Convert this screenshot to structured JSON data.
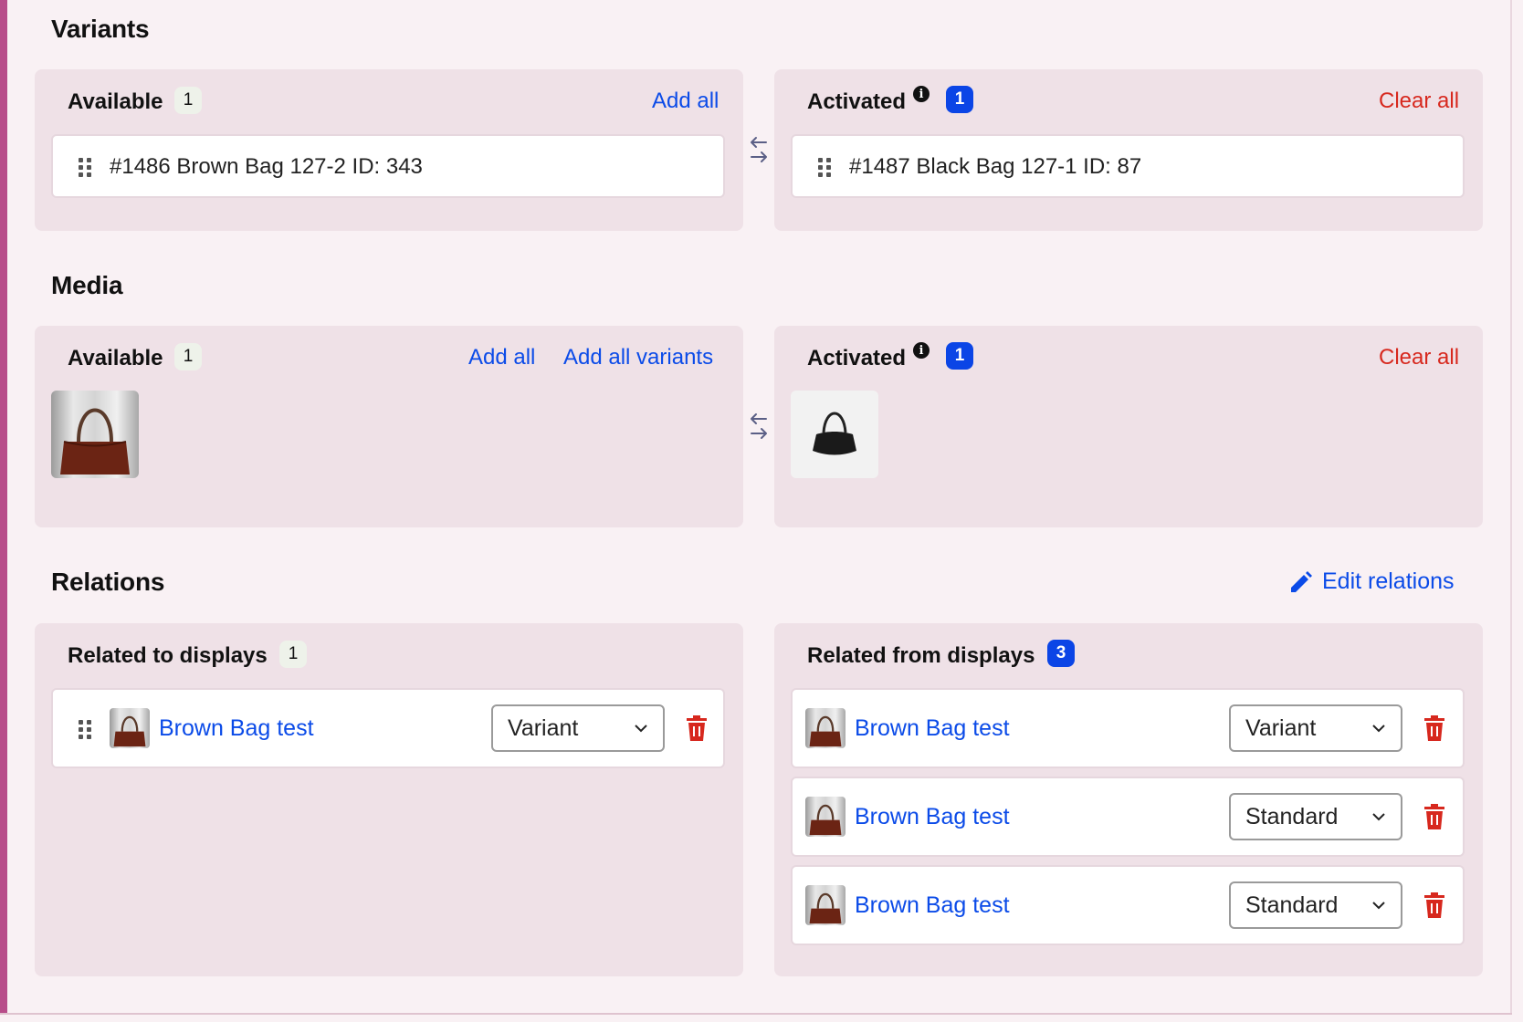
{
  "colors": {
    "accent_bar": "#b84d8a",
    "link_blue": "#0b4be8",
    "danger_red": "#d7281e",
    "panel_bg": "#efe1e7",
    "page_bg": "#f9f1f4",
    "badge_blue": "#0b45e6"
  },
  "variants": {
    "title": "Variants",
    "available": {
      "label": "Available",
      "count": "1",
      "add_all": "Add all",
      "items": [
        "#1486 Brown Bag 127-2 ID: 343"
      ]
    },
    "activated": {
      "label": "Activated",
      "count": "1",
      "clear_all": "Clear all",
      "items": [
        "#1487 Black Bag 127-1 ID: 87"
      ]
    }
  },
  "media": {
    "title": "Media",
    "available": {
      "label": "Available",
      "count": "1",
      "add_all": "Add all",
      "add_all_variants": "Add all variants",
      "thumbnails": [
        "brown-bag-thumbnail"
      ]
    },
    "activated": {
      "label": "Activated",
      "count": "1",
      "clear_all": "Clear all",
      "thumbnails": [
        "black-bag-thumbnail"
      ]
    }
  },
  "relations": {
    "title": "Relations",
    "edit_label": "Edit relations",
    "related_to": {
      "label": "Related to displays",
      "count": "1",
      "items": [
        {
          "name": "Brown Bag test",
          "type": "Variant"
        }
      ]
    },
    "related_from": {
      "label": "Related from displays",
      "count": "3",
      "items": [
        {
          "name": "Brown Bag test",
          "type": "Variant"
        },
        {
          "name": "Brown Bag test",
          "type": "Standard"
        },
        {
          "name": "Brown Bag test",
          "type": "Standard"
        }
      ]
    }
  },
  "icons": {
    "info": "info-icon",
    "swap": "swap-arrows-icon",
    "drag": "drag-handle-icon",
    "trash": "trash-icon",
    "pencil": "pencil-icon",
    "chevron": "chevron-down-icon"
  }
}
